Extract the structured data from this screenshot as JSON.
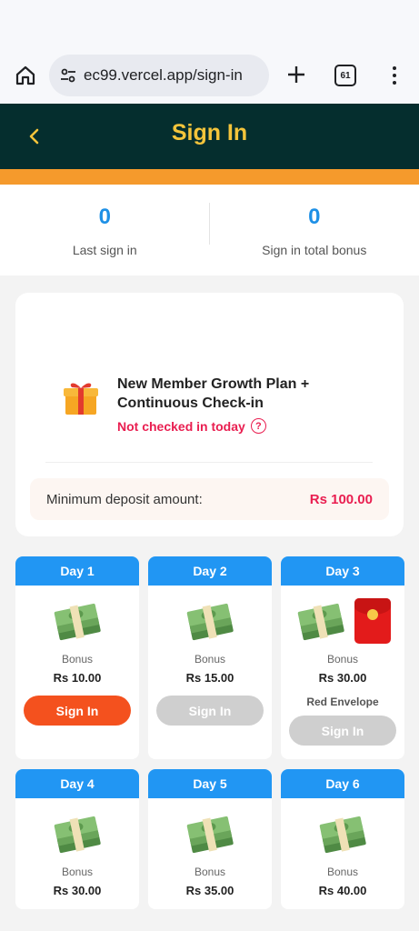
{
  "browser": {
    "url": "ec99.vercel.app/sign-in",
    "tab_count": "61"
  },
  "header": {
    "title": "Sign In"
  },
  "stats": [
    {
      "value": "0",
      "label": "Last sign in"
    },
    {
      "value": "0",
      "label": "Sign in total bonus"
    }
  ],
  "plan": {
    "title": "New Member Growth Plan + Continuous Check-in",
    "status": "Not checked in today",
    "help_glyph": "?",
    "deposit_label": "Minimum deposit amount:",
    "deposit_value": "Rs 100.00"
  },
  "days": [
    {
      "label": "Day 1",
      "bonus_label": "Bonus",
      "bonus_value": "Rs 10.00",
      "button": "Sign In",
      "state": "active"
    },
    {
      "label": "Day 2",
      "bonus_label": "Bonus",
      "bonus_value": "Rs 15.00",
      "button": "Sign In",
      "state": "disabled"
    },
    {
      "label": "Day 3",
      "bonus_label": "Bonus",
      "bonus_value": "Rs 30.00",
      "extra": "Red Envelope",
      "button": "Sign In",
      "state": "disabled"
    },
    {
      "label": "Day 4",
      "bonus_label": "Bonus",
      "bonus_value": "Rs 30.00"
    },
    {
      "label": "Day 5",
      "bonus_label": "Bonus",
      "bonus_value": "Rs 35.00"
    },
    {
      "label": "Day 6",
      "bonus_label": "Bonus",
      "bonus_value": "Rs 40.00"
    }
  ],
  "colors": {
    "header_bg": "#052e2e",
    "title": "#f4c43b",
    "accent_orange": "#f59a2c",
    "day_header": "#2196f3",
    "sign_in_active": "#f4511e",
    "highlight_red": "#e91e50"
  }
}
